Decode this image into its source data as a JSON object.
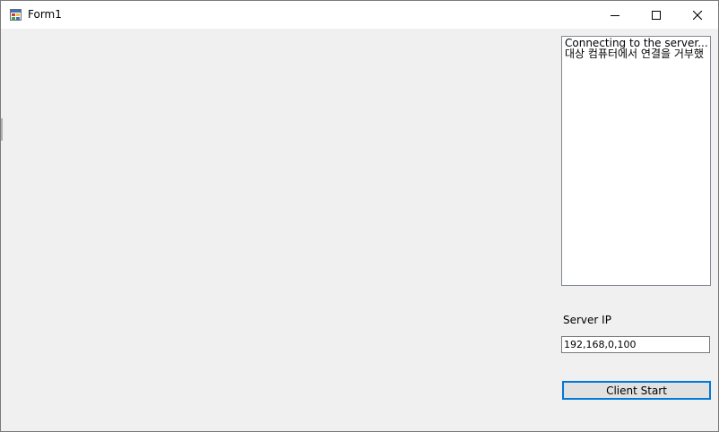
{
  "window": {
    "title": "Form1",
    "icon": "winforms-app-icon",
    "controls": {
      "minimize_icon": "minimize-icon",
      "maximize_icon": "maximize-icon",
      "close_icon": "close-icon"
    }
  },
  "log": {
    "lines": [
      "Connecting to the server...",
      "대상 컴퓨터에서 연결을 거부했"
    ]
  },
  "server": {
    "label": "Server IP",
    "ip_value": "192,168,0,100"
  },
  "actions": {
    "start_label": "Client Start"
  },
  "colors": {
    "window_bg": "#f0f0f0",
    "titlebar_bg": "#ffffff",
    "button_bg": "#e1e1e1",
    "focus_border": "#0078d7"
  }
}
